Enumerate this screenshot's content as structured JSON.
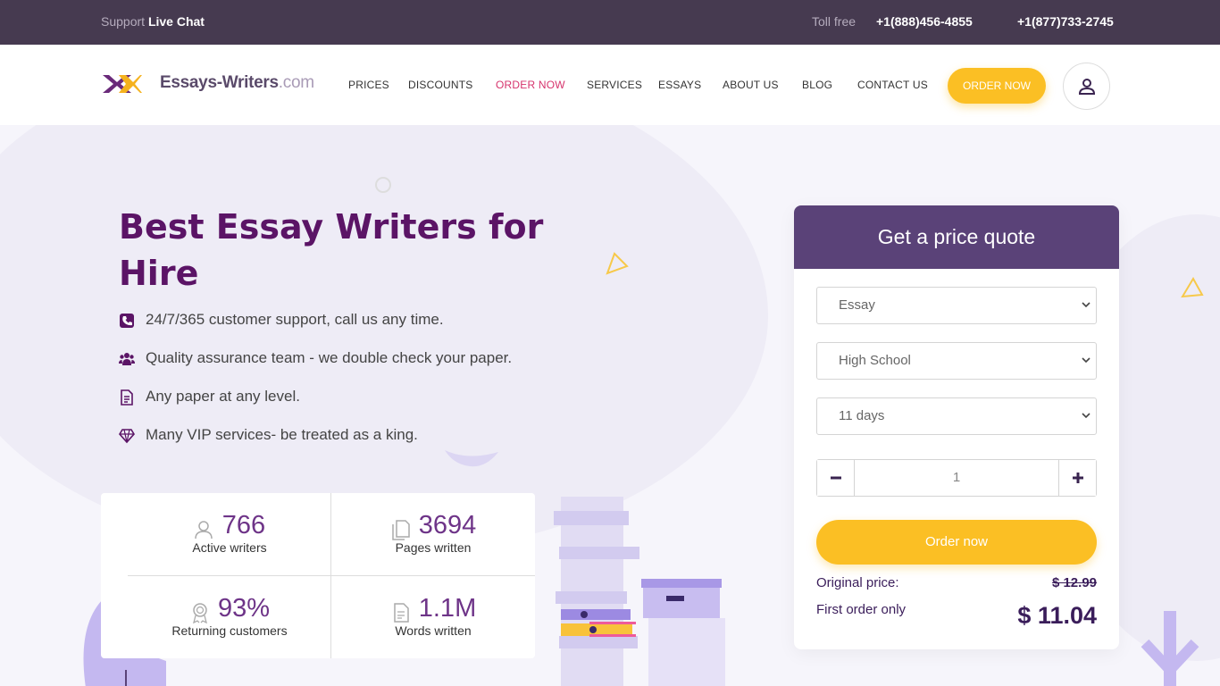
{
  "topbar": {
    "support_label": "Support",
    "live_chat": "Live Chat",
    "toll_free_label": "Toll free",
    "phone_1": "+1(888)456-4855",
    "phone_2": "+1(877)733-2745"
  },
  "header": {
    "logo_name": "Essays-Writers",
    "logo_tld": ".com",
    "menu": [
      "PRICES",
      "DISCOUNTS",
      "ORDER NOW",
      "SERVICES",
      "ESSAYS",
      "ABOUT US",
      "BLOG",
      "CONTACT US"
    ],
    "order_button": "ORDER NOW",
    "user_icon": "user-icon"
  },
  "hero": {
    "title": "Best Essay Writers for Hire",
    "features": [
      {
        "icon": "phone-icon",
        "text": "24/7/365 customer support, call us any time."
      },
      {
        "icon": "users-icon",
        "text": "Quality assurance team - we double check your paper."
      },
      {
        "icon": "document-icon",
        "text": "Any paper at any level."
      },
      {
        "icon": "diamond-icon",
        "text": "Many VIP services- be treated as a king."
      }
    ]
  },
  "stats": [
    {
      "icon": "writer-icon",
      "value": "766",
      "label": "Active writers"
    },
    {
      "icon": "pages-icon",
      "value": "3694",
      "label": "Pages written"
    },
    {
      "icon": "award-icon",
      "value": "93%",
      "label": "Returning customers"
    },
    {
      "icon": "words-icon",
      "value": "1.1M",
      "label": "Words written"
    }
  ],
  "quote": {
    "title": "Get a price quote",
    "paper_type": "Essay",
    "level": "High School",
    "deadline": "11 days",
    "pages": "1",
    "order_button": "Order now",
    "original_price_label": "Original price:",
    "original_price": "$ 12.99",
    "first_order_label": "First order only",
    "final_price": "$ 11.04"
  },
  "colors": {
    "topbar": "#463a50",
    "heading": "#5b1466",
    "accent": "#fbbf24",
    "quote_header": "#5a4278",
    "active_menu": "#d6336c"
  }
}
